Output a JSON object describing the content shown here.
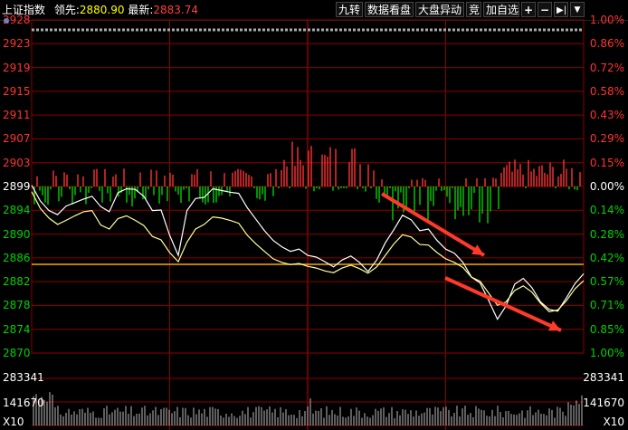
{
  "header": {
    "index_name": "上证指数",
    "lead_label": "领先:",
    "lead_value": "2880.90",
    "last_label": "最新:",
    "last_value": "2883.74",
    "buttons": [
      "九转",
      "数据看盘",
      "大盘异动",
      "竞",
      "加自选"
    ]
  },
  "price_axis": [
    "2928",
    "2923",
    "2919",
    "2915",
    "2911",
    "2907",
    "2903",
    "2899",
    "2894",
    "2890",
    "2886",
    "2882",
    "2878",
    "2874",
    "2870"
  ],
  "pct_axis": [
    "1.00%",
    "0.86%",
    "0.72%",
    "0.58%",
    "0.43%",
    "0.29%",
    "0.15%",
    "0.00%",
    "0.14%",
    "0.28%",
    "0.42%",
    "0.57%",
    "0.71%",
    "0.85%",
    "1.00%"
  ],
  "volume_axis": {
    "top_left": "283341",
    "mid_left": "141670",
    "unit_left": "X10",
    "top_right": "283341",
    "mid_right": "141670",
    "unit_right": "X10"
  },
  "colors": {
    "up": "#ff3232",
    "down": "#00d200",
    "grid": "#8b0000",
    "index_line": "#ffffff",
    "lead_line": "#ffff99",
    "prev_close_line": "#ffa500",
    "annotation_arrow": "#ff3a2a"
  },
  "chart_data": {
    "type": "line",
    "title": "上证指数",
    "ylim": [
      2870,
      2928
    ],
    "prev_close": 2899,
    "series": [
      {
        "name": "最新",
        "values": [
          2899.2,
          2896.5,
          2894.8,
          2894.1,
          2895.6,
          2896.2,
          2896.8,
          2897.3,
          2895.5,
          2894.6,
          2897.9,
          2898.6,
          2898.5,
          2897.3,
          2894.8,
          2894.9,
          2890.5,
          2887.0,
          2894.8,
          2896.9,
          2897.1,
          2898.6,
          2898.3,
          2898.0,
          2897.8,
          2895.3,
          2893.3,
          2891.3,
          2889.6,
          2888.5,
          2887.7,
          2888.1,
          2887.0,
          2886.7,
          2885.9,
          2885.0,
          2886.2,
          2886.9,
          2885.8,
          2884.2,
          2886.2,
          2889.2,
          2891.5,
          2894.0,
          2893.2,
          2891.3,
          2891.6,
          2889.6,
          2888.1,
          2887.4,
          2885.8,
          2883.2,
          2882.2,
          2879.1,
          2875.9,
          2878.2,
          2882.0,
          2883.0,
          2881.4,
          2878.9,
          2877.6,
          2877.3,
          2879.6,
          2882.1,
          2883.8
        ]
      },
      {
        "name": "领先",
        "values": [
          2898.1,
          2895.2,
          2893.5,
          2892.4,
          2893.1,
          2893.9,
          2894.6,
          2894.8,
          2892.3,
          2891.6,
          2893.4,
          2893.9,
          2893.1,
          2892.2,
          2890.3,
          2889.7,
          2887.5,
          2885.9,
          2889.3,
          2891.6,
          2892.4,
          2893.7,
          2893.5,
          2893.1,
          2892.6,
          2890.5,
          2889.0,
          2887.7,
          2886.4,
          2885.8,
          2885.4,
          2885.6,
          2885.1,
          2884.8,
          2884.3,
          2884.0,
          2884.8,
          2885.3,
          2884.7,
          2883.9,
          2885.0,
          2887.0,
          2889.0,
          2890.6,
          2890.2,
          2888.9,
          2888.8,
          2887.5,
          2886.4,
          2885.8,
          2884.9,
          2883.2,
          2882.5,
          2880.4,
          2878.3,
          2878.9,
          2880.9,
          2881.7,
          2880.6,
          2878.7,
          2877.2,
          2877.5,
          2879.1,
          2881.2,
          2882.6
        ]
      }
    ]
  }
}
